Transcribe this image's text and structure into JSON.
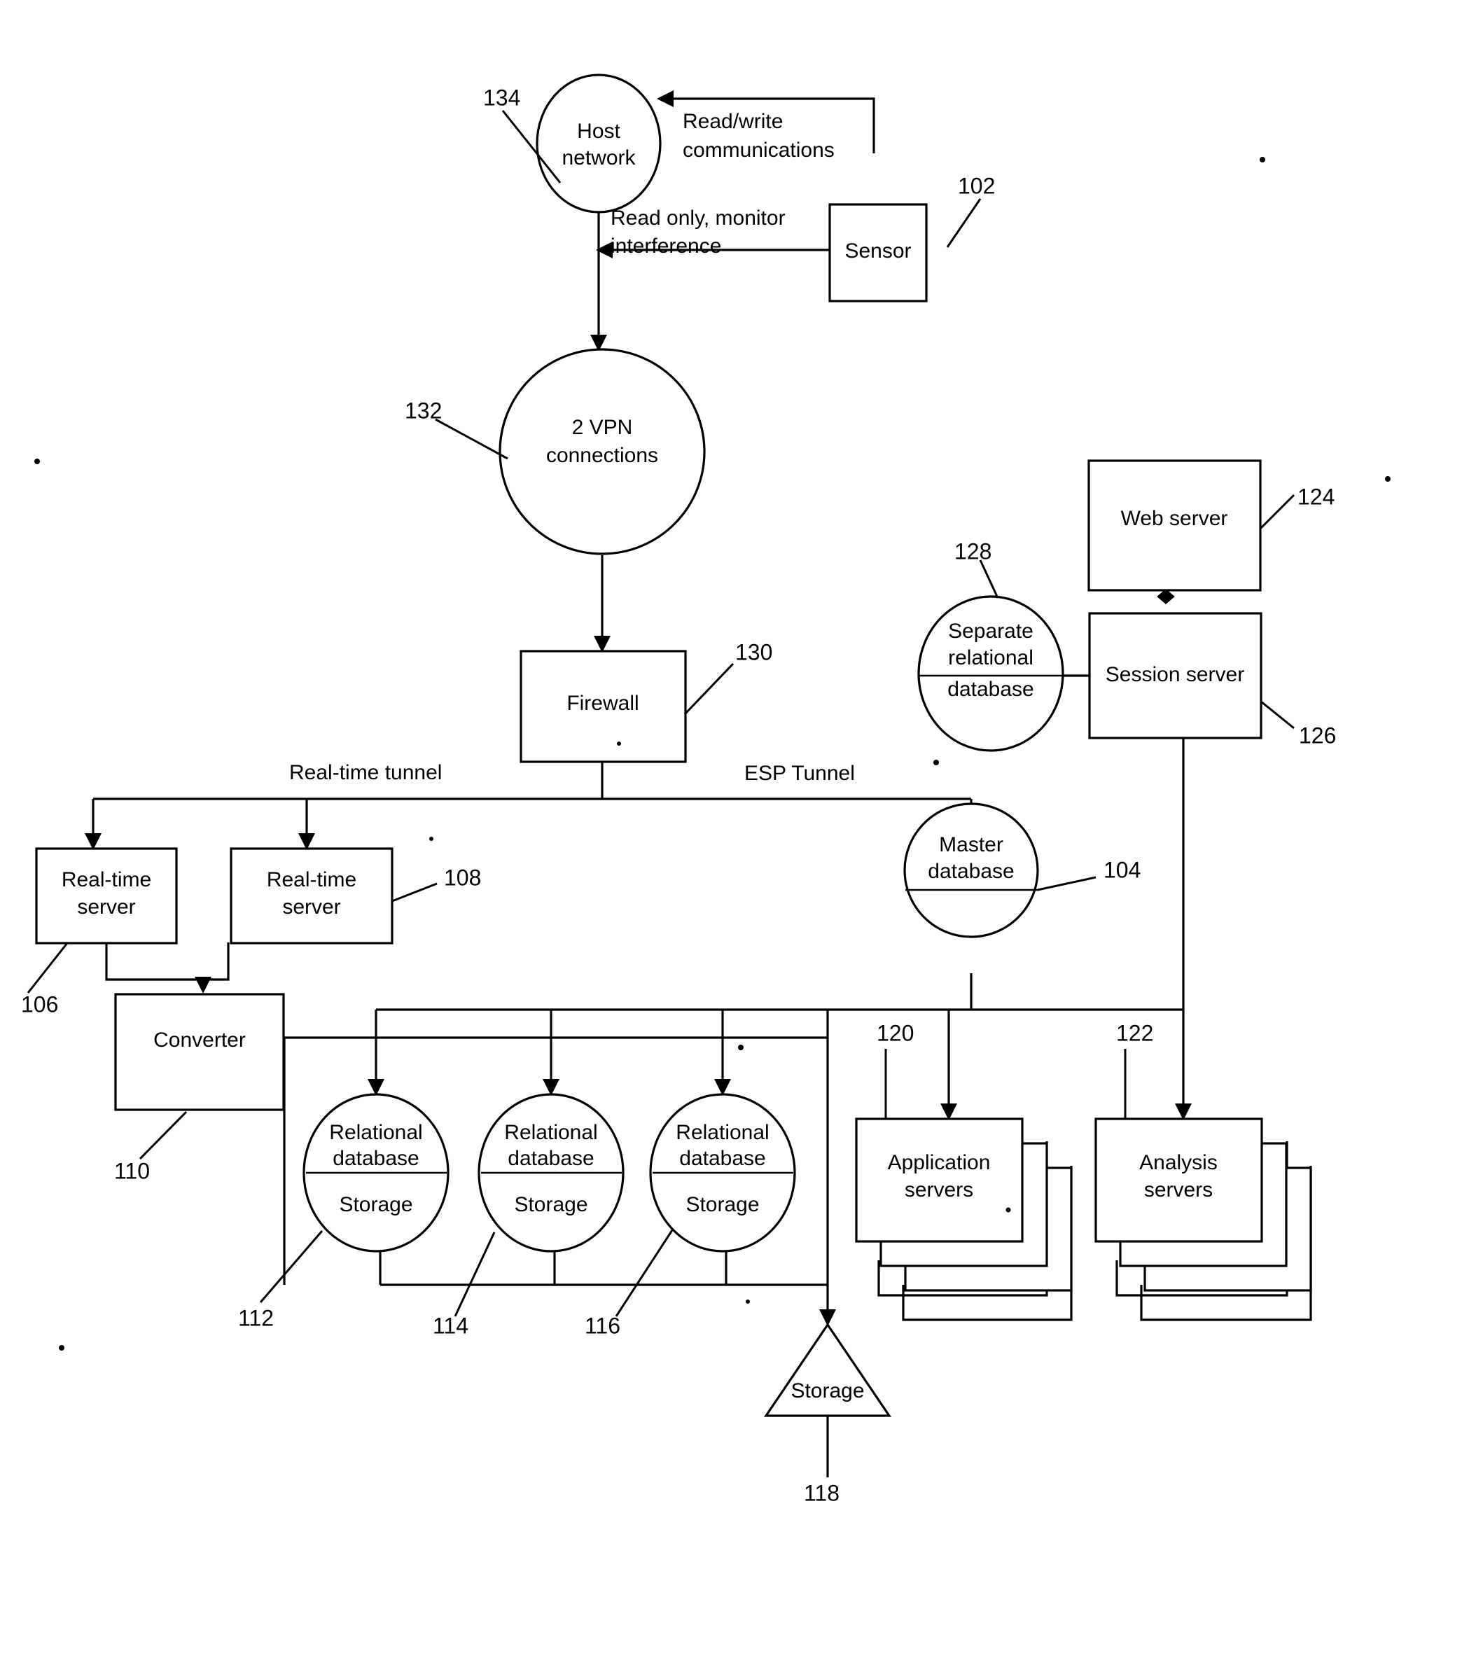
{
  "figure": {
    "type": "patent-network-architecture-diagram",
    "background_color": "#ffffff",
    "line_color": "#000000"
  },
  "nodes": {
    "host_network": {
      "label_line1": "Host",
      "label_line2": "network",
      "shape": "ellipse",
      "ref": "134"
    },
    "sensor": {
      "label": "Sensor",
      "shape": "rectangle",
      "ref": "102"
    },
    "vpn": {
      "label_line1": "2 VPN",
      "label_line2": "connections",
      "shape": "circle",
      "ref": "132"
    },
    "firewall": {
      "label": "Firewall",
      "shape": "rectangle",
      "ref": "130"
    },
    "web_server": {
      "label": "Web server",
      "shape": "rectangle",
      "ref": "124"
    },
    "session_server": {
      "label": "Session server",
      "shape": "rectangle",
      "ref": "126"
    },
    "separate_relational_database": {
      "label_line1": "Separate",
      "label_line2": "relational",
      "label_line3": "database",
      "shape": "ellipse-split",
      "ref": "128"
    },
    "master_database": {
      "label_line1": "Master",
      "label_line2": "database",
      "shape": "circle-split",
      "ref": "104"
    },
    "real_time_server_1": {
      "label_line1": "Real-time",
      "label_line2": "server",
      "shape": "rectangle",
      "ref": "106"
    },
    "real_time_server_2": {
      "label_line1": "Real-time",
      "label_line2": "server",
      "shape": "rectangle",
      "ref": "108"
    },
    "converter": {
      "label": "Converter",
      "shape": "rectangle",
      "ref": "110"
    },
    "relational_database_1": {
      "label_line1": "Relational",
      "label_line2": "database",
      "label_line3": "Storage",
      "shape": "circle-split",
      "ref": "112"
    },
    "relational_database_2": {
      "label_line1": "Relational",
      "label_line2": "database",
      "label_line3": "Storage",
      "shape": "circle-split",
      "ref": "114"
    },
    "relational_database_3": {
      "label_line1": "Relational",
      "label_line2": "database",
      "label_line3": "Storage",
      "shape": "circle-split",
      "ref": "116"
    },
    "storage": {
      "label": "Storage",
      "shape": "triangle",
      "ref": "118"
    },
    "application_servers": {
      "label_line1": "Application",
      "label_line2": "servers",
      "shape": "stacked-rectangle",
      "ref": "120"
    },
    "analysis_servers": {
      "label_line1": "Analysis",
      "label_line2": "servers",
      "shape": "stacked-rectangle",
      "ref": "122"
    }
  },
  "edge_labels": {
    "read_write": {
      "line1": "Read/write",
      "line2": "communications"
    },
    "read_only": {
      "line1": "Read only, monitor",
      "line2": "interference"
    },
    "real_time_tunnel": "Real-time tunnel",
    "esp_tunnel": "ESP Tunnel"
  },
  "reference_numbers": [
    "102",
    "104",
    "106",
    "108",
    "110",
    "112",
    "114",
    "116",
    "118",
    "120",
    "122",
    "124",
    "126",
    "128",
    "130",
    "132",
    "134"
  ]
}
